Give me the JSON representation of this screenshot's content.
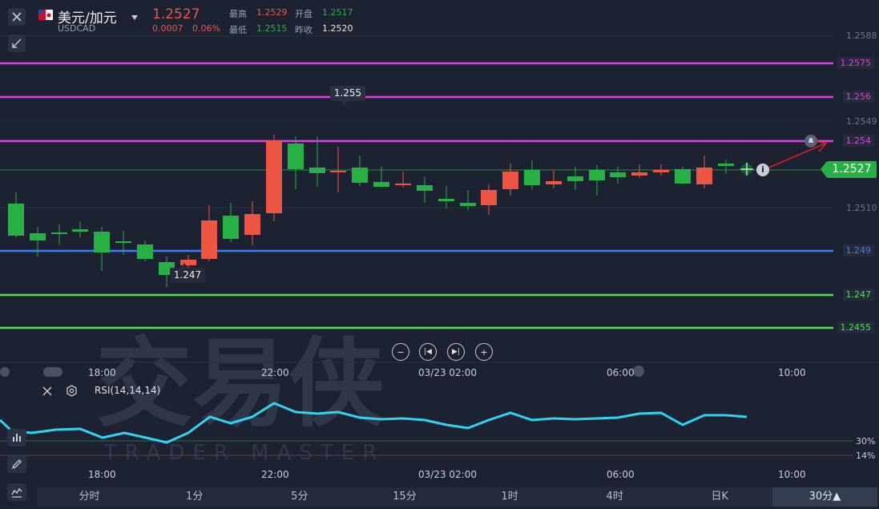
{
  "symbol": {
    "name": "美元/加元",
    "code": "USDCAD",
    "price": "1.2527",
    "change": "0.0007",
    "change_pct": "0.06%"
  },
  "stats": {
    "high_label": "最高",
    "high": "1.2529",
    "open_label": "开盘",
    "open": "1.2517",
    "low_label": "最低",
    "low": "1.2515",
    "prev_close_label": "昨收",
    "prev_close": "1.2520"
  },
  "y_axis_labels": [
    "1.2588",
    "1.2549",
    "1.2510"
  ],
  "levels": [
    {
      "label": "1.2575",
      "color": "#e040e0"
    },
    {
      "label": "1.256",
      "color": "#e040e0"
    },
    {
      "label": "1.254",
      "color": "#e040e0"
    },
    {
      "label": "1.249",
      "color": "#3f7fff"
    },
    {
      "label": "1.247",
      "color": "#55e055"
    },
    {
      "label": "1.2455",
      "color": "#55e055"
    }
  ],
  "current_price_tag": "1.2527",
  "callouts": {
    "high": "1.255",
    "low": "1.247"
  },
  "time_axis": [
    "18:00",
    "22:00",
    "03/23 02:00",
    "06:00",
    "10:00"
  ],
  "rsi": {
    "label": "RSI(14,14,14)",
    "level_30": "30%",
    "level_14": "14%"
  },
  "watermark": {
    "logo": "交易侠",
    "text": "TRADER MASTER"
  },
  "timeframes": [
    "分时",
    "1分",
    "5分",
    "15分",
    "1时",
    "4时",
    "日K",
    "30分▲"
  ],
  "active_timeframe": "30分▲",
  "colors": {
    "up": "#27b043",
    "down": "#ee5545",
    "bg": "#1c2232",
    "rsi_line": "#2fd4f0"
  },
  "icons": [
    "close-icon",
    "flag-icon",
    "dropdown-icon",
    "shrink-icon",
    "zoom-out-icon",
    "step-back-icon",
    "step-forward-icon",
    "zoom-in-icon",
    "eye-icon",
    "settings-icon",
    "indicator-icon",
    "pen-icon",
    "chart-icon",
    "alert-bell-icon"
  ]
}
